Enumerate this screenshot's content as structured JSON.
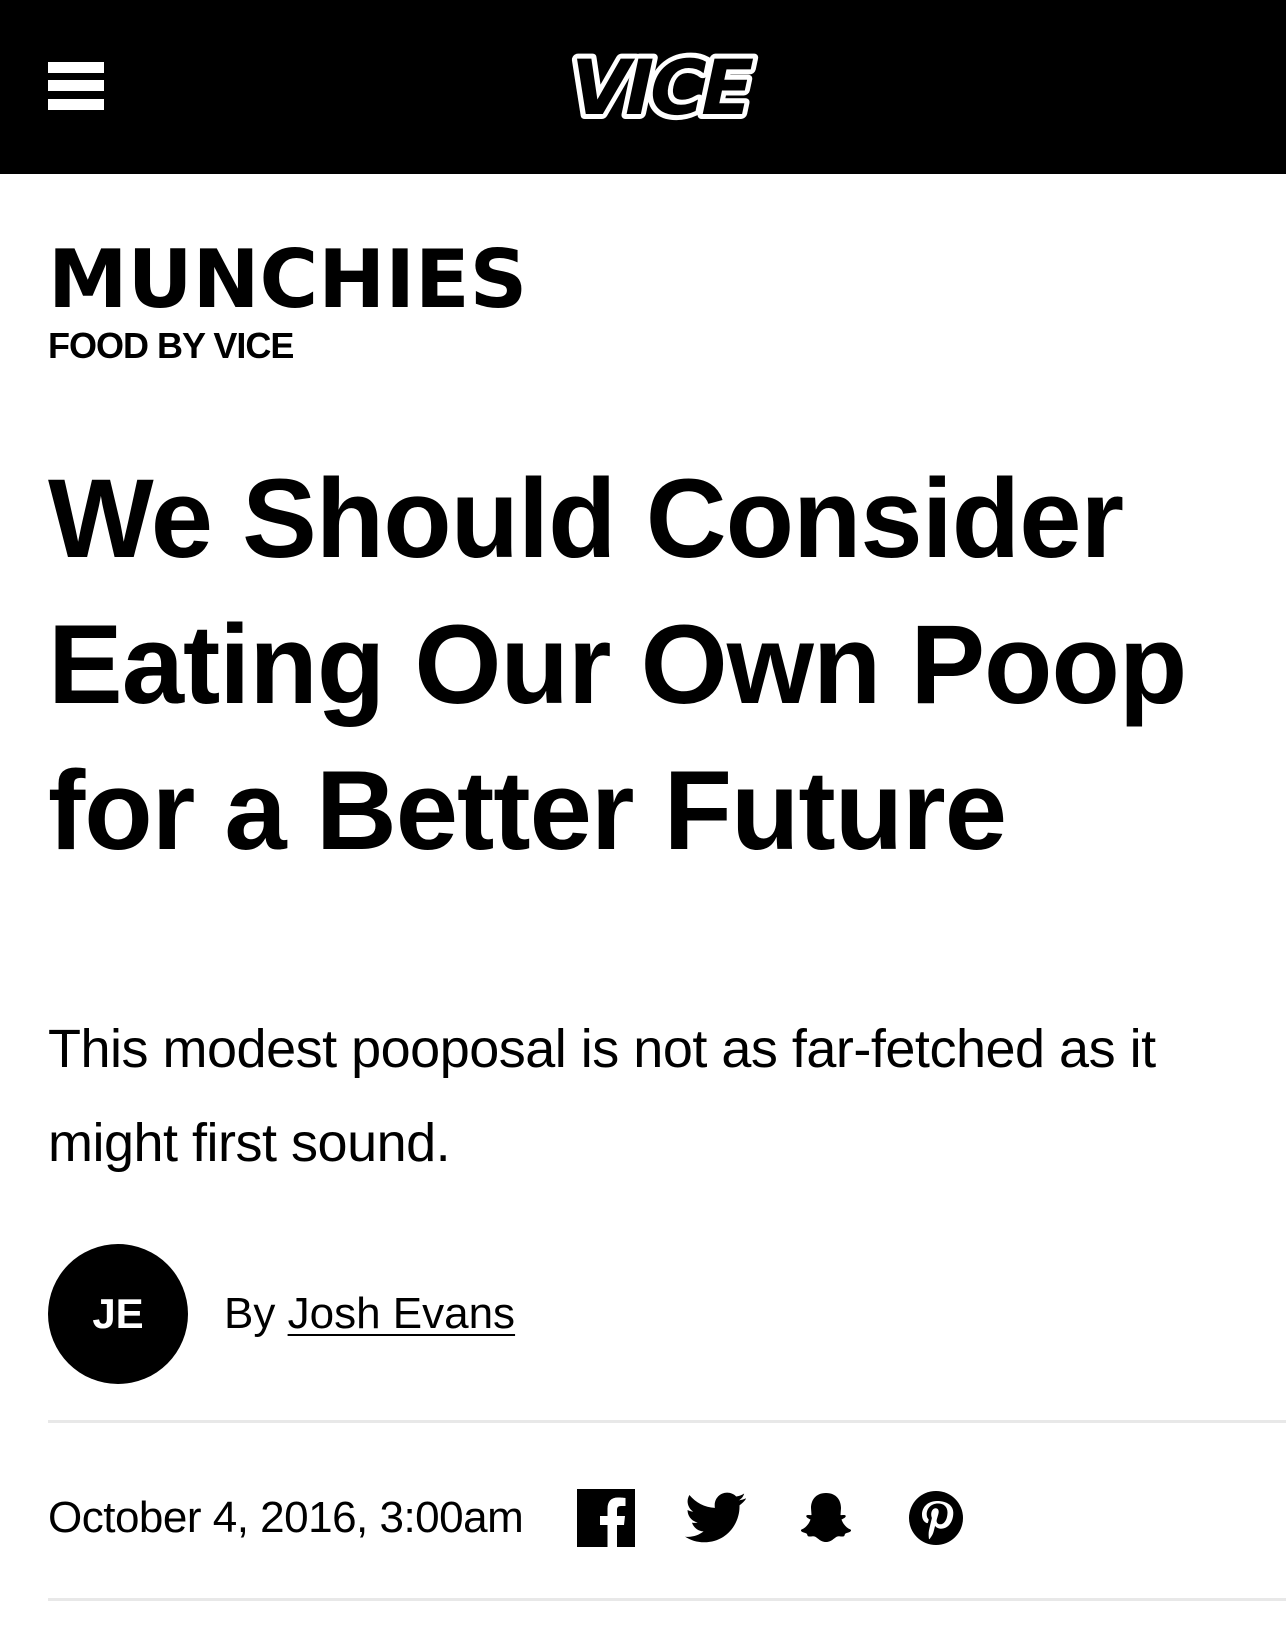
{
  "header": {
    "menu_icon": "hamburger-menu-icon",
    "logo_text": "VICE"
  },
  "section": {
    "name": "MUNCHIES",
    "tagline": "FOOD BY VICE"
  },
  "article": {
    "headline": "We Should Consider Eating Our Own Poop for a Better Future",
    "dek": "This modest pooposal is not as far-fetched as it might first sound.",
    "author": {
      "initials": "JE",
      "by_label": "By",
      "name": "Josh Evans"
    },
    "published": "October 4, 2016, 3:00am"
  },
  "share": {
    "icons": [
      "facebook-icon",
      "twitter-icon",
      "snapchat-icon",
      "pinterest-icon"
    ]
  },
  "colors": {
    "header_bg": "#000000",
    "text": "#000000",
    "background": "#ffffff",
    "divider": "#e8e8e8"
  }
}
